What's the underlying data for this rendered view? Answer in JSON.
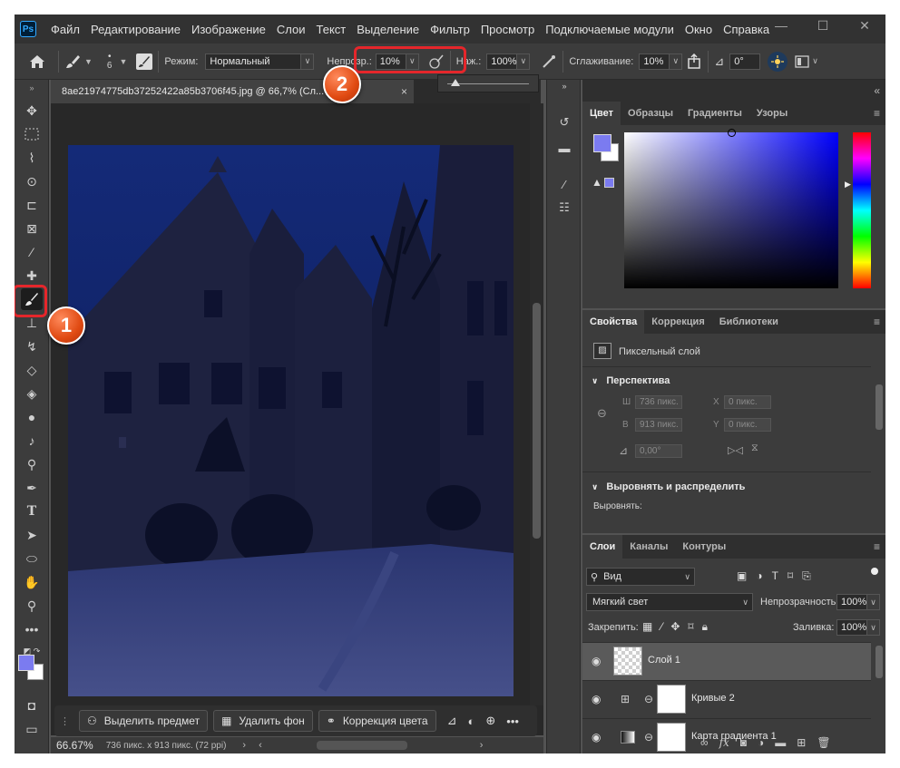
{
  "app": {
    "logo": "Ps"
  },
  "menu": [
    "Файл",
    "Редактирование",
    "Изображение",
    "Слои",
    "Текст",
    "Выделение",
    "Фильтр",
    "Просмотр",
    "Подключаемые модули",
    "Окно",
    "Справка"
  ],
  "window_controls": {
    "minimize": "—",
    "maximize": "☐",
    "close": "✕"
  },
  "options": {
    "brush_size": "6",
    "mode_label": "Режим:",
    "mode_value": "Нормальный",
    "opacity_label": "Непрозр.:",
    "opacity_value": "10%",
    "pressure_label": "Наж.:",
    "pressure_value": "100%",
    "smoothing_label": "Сглаживание:",
    "smoothing_value": "10%",
    "angle_value": "0°",
    "opacity_slider_fraction": 0.1
  },
  "document": {
    "tab_title": "8ae21974775db37252422a85b3706f45.jpg @ 66,7% (Сл... B/8*) *",
    "close": "×"
  },
  "taskbar": {
    "select_subject": "Выделить предмет",
    "remove_bg": "Удалить фон",
    "color_correction": "Коррекция цвета"
  },
  "status": {
    "zoom": "66.67%",
    "info": "736 пикс. x 913 пикс. (72 ppi)"
  },
  "color_panel": {
    "tabs": [
      "Цвет",
      "Образцы",
      "Градиенты",
      "Узоры"
    ],
    "foreground": "#7b7bf0",
    "background": "#ffffff"
  },
  "properties_panel": {
    "tabs": [
      "Свойства",
      "Коррекция",
      "Библиотеки"
    ],
    "layer_type": "Пиксельный слой",
    "section_perspective": "Перспектива",
    "w_label": "Ш",
    "w_value": "736 пикс.",
    "h_label": "В",
    "h_value": "913 пикс.",
    "x_label": "X",
    "x_value": "0 пикс.",
    "y_label": "Y",
    "y_value": "0 пикс.",
    "angle_value": "0,00°",
    "section_align": "Выровнять и распределить",
    "align_label": "Выровнять:"
  },
  "layers_panel": {
    "tabs": [
      "Слои",
      "Каналы",
      "Контуры"
    ],
    "filter_label": "Вид",
    "blend_mode": "Мягкий свет",
    "opacity_label": "Непрозрачность:",
    "opacity_value": "100%",
    "lock_label": "Закрепить:",
    "fill_label": "Заливка:",
    "fill_value": "100%",
    "layers": [
      {
        "name": "Слой 1"
      },
      {
        "name": "Кривые 2"
      },
      {
        "name": "Карта градиента 1"
      }
    ]
  },
  "markers": {
    "one": "1",
    "two": "2"
  }
}
